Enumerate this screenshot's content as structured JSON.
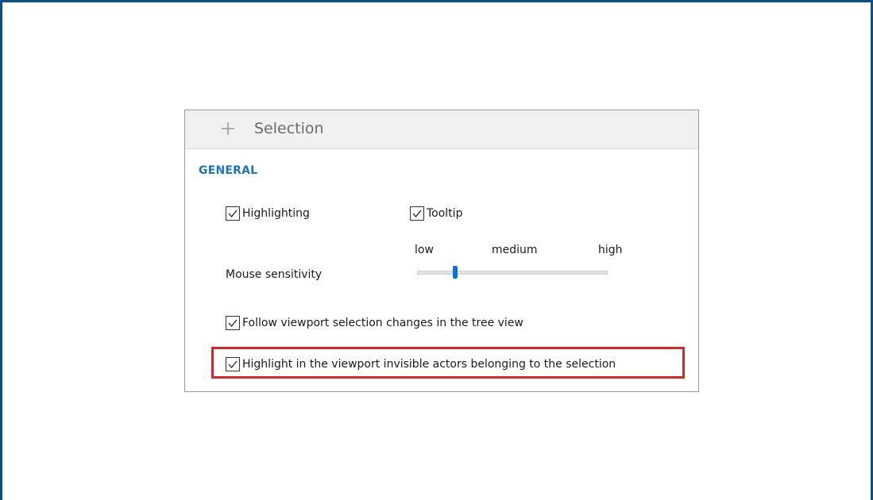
{
  "panel": {
    "title": "Selection",
    "expand_icon": "plus-icon"
  },
  "general": {
    "section_title": "GENERAL",
    "highlighting": {
      "label": "Highlighting",
      "checked": true
    },
    "tooltip": {
      "label": "Tooltip",
      "checked": true
    },
    "mouse_sensitivity": {
      "label": "Mouse sensitivity",
      "ticks": [
        "low",
        "medium",
        "high"
      ],
      "value_fraction": 0.2
    },
    "follow_viewport": {
      "label": "Follow viewport selection changes in the tree view",
      "checked": true
    },
    "highlight_invisible": {
      "label": "Highlight in the viewport invisible actors belonging to the selection",
      "checked": true
    }
  },
  "colors": {
    "frame": "#0b4f8a",
    "section_title": "#1a73c7",
    "slider_thumb": "#0a74d6",
    "highlight_box": "#d62828"
  }
}
